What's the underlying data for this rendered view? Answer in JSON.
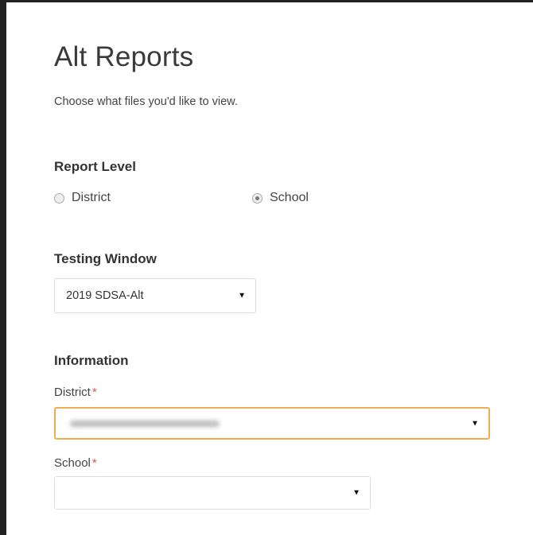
{
  "page": {
    "title": "Alt Reports",
    "subtitle": "Choose what files you'd like to view."
  },
  "report_level": {
    "heading": "Report Level",
    "options": [
      {
        "label": "District",
        "checked": false
      },
      {
        "label": "School",
        "checked": true
      }
    ]
  },
  "testing_window": {
    "heading": "Testing Window",
    "selected": "2019 SDSA-Alt"
  },
  "information": {
    "heading": "Information",
    "district": {
      "label": "District",
      "required_marker": "*",
      "value": ""
    },
    "school": {
      "label": "School",
      "required_marker": "*",
      "value": ""
    }
  },
  "icons": {
    "dropdown_caret": "caret-down-icon"
  },
  "colors": {
    "required": "#d9534f",
    "focus_border": "#f0ad4e"
  }
}
